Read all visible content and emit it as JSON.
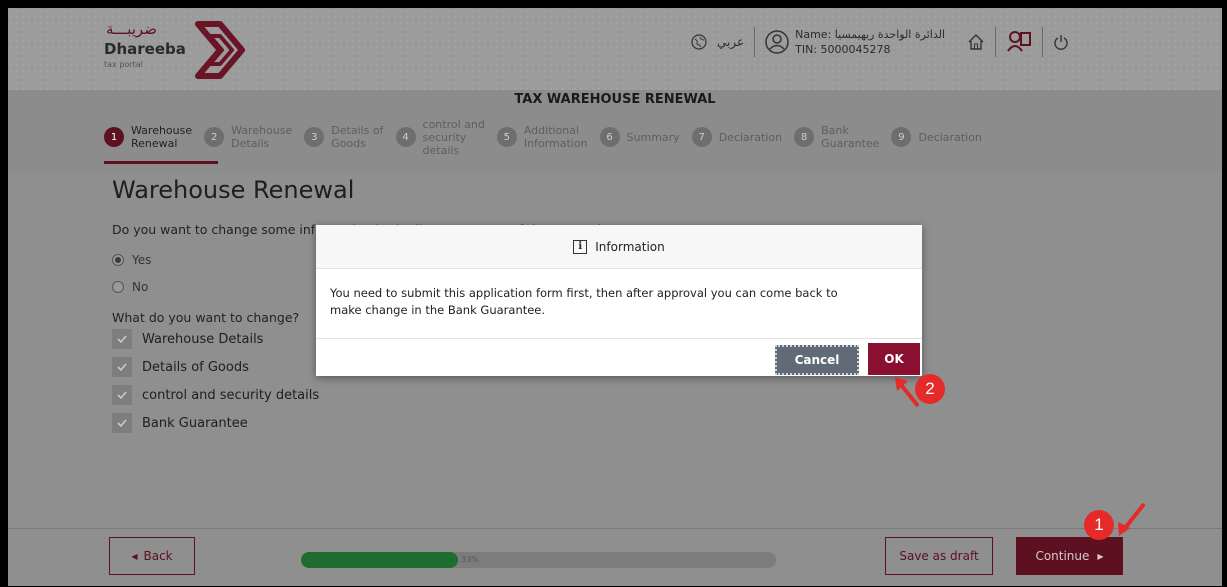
{
  "header": {
    "logo_arabic": "ضريبـــة",
    "logo_english": "Dhareeba",
    "logo_sub": "tax portal",
    "language_label": "عربي",
    "user_name": "Name: الدائرة الواحدة ريهيمسيا",
    "user_tin": "TIN: 5000045278"
  },
  "page": {
    "head_title": "TAX WAREHOUSE RENEWAL",
    "content_title": "Warehouse Renewal",
    "question": "Do you want to change some information in the licence as part of the renewal? *",
    "radio_yes": "Yes",
    "radio_no": "No",
    "what_change": "What do you want to change?",
    "selected_option": "Yes"
  },
  "steps": [
    {
      "num": "1",
      "line1": "Warehouse",
      "line2": "Renewal",
      "active": true
    },
    {
      "num": "2",
      "line1": "Warehouse",
      "line2": "Details"
    },
    {
      "num": "3",
      "line1": "Details of",
      "line2": "Goods"
    },
    {
      "num": "4",
      "line1": "control and",
      "line2": "security",
      "line3": "details"
    },
    {
      "num": "5",
      "line1": "Additional",
      "line2": "Information"
    },
    {
      "num": "6",
      "line1": "Summary"
    },
    {
      "num": "7",
      "line1": "Declaration"
    },
    {
      "num": "8",
      "line1": "Bank",
      "line2": "Guarantee"
    },
    {
      "num": "9",
      "line1": "Declaration"
    }
  ],
  "checkboxes": [
    "Warehouse Details",
    "Details of Goods",
    "control and security details",
    "Bank Guarantee"
  ],
  "footer": {
    "back_label": "Back",
    "draft_label": "Save as draft",
    "continue_label": "Continue",
    "progress_text": "33%",
    "progress_value": 0.33
  },
  "modal": {
    "title": "Information",
    "info_glyph": "i",
    "message_line1": "You need to submit this application form first, then after approval you can come back to",
    "message_line2": "make change in the Bank Guarantee.",
    "cancel_label": "Cancel",
    "ok_label": "OK"
  },
  "annotations": {
    "badge1": "1",
    "badge2": "2",
    "color": "#e52a2a"
  },
  "colors": {
    "brand": "#5c1020",
    "ok": "#8a1030",
    "cancel": "#616b76",
    "progress": "#1e6d2e"
  }
}
